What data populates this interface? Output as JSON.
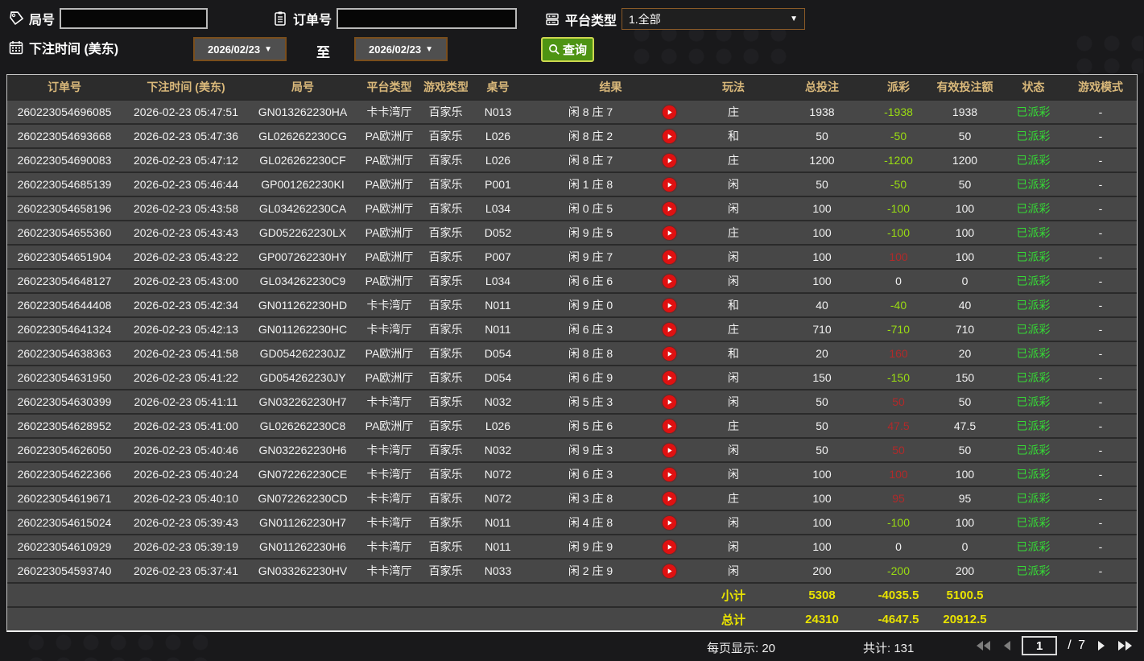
{
  "filters": {
    "round_label": "局号",
    "round_value": "",
    "order_label": "订单号",
    "order_value": "",
    "platform_label": "平台类型",
    "platform_value": "1.全部",
    "bet_time_label": "下注时间 (美东)",
    "date_from": "2026/02/23",
    "to_label": "至",
    "date_to": "2026/02/23",
    "search_label": "查询"
  },
  "colors": {
    "payout_negative": "#9adc12",
    "payout_positive": "#b02a2a",
    "status_green": "#35da35",
    "totals_yellow": "#e9e300",
    "header_gold": "#d9b87a",
    "search_button_green": "#4e9413",
    "play_icon_red": "#e01111"
  },
  "table": {
    "columns": [
      "订单号",
      "下注时间 (美东)",
      "局号",
      "平台类型",
      "游戏类型",
      "桌号",
      "结果",
      "玩法",
      "总投注",
      "派彩",
      "有效投注额",
      "状态",
      "游戏模式"
    ],
    "rows": [
      {
        "order_id": "260223054696085",
        "bet_time": "2026-02-23 05:47:51",
        "round_id": "GN013262230HA",
        "platform": "卡卡湾厅",
        "game_type": "百家乐",
        "table_no": "N013",
        "result": "闲 8 庄 7",
        "bet_type": "庄",
        "total_bet": "1938",
        "payout": "-1938",
        "payout_class": "pay-neg",
        "valid_bet": "1938",
        "status": "已派彩",
        "game_mode": "-"
      },
      {
        "order_id": "260223054693668",
        "bet_time": "2026-02-23 05:47:36",
        "round_id": "GL026262230CG",
        "platform": "PA欧洲厅",
        "game_type": "百家乐",
        "table_no": "L026",
        "result": "闲 8 庄 2",
        "bet_type": "和",
        "total_bet": "50",
        "payout": "-50",
        "payout_class": "pay-neg",
        "valid_bet": "50",
        "status": "已派彩",
        "game_mode": "-"
      },
      {
        "order_id": "260223054690083",
        "bet_time": "2026-02-23 05:47:12",
        "round_id": "GL026262230CF",
        "platform": "PA欧洲厅",
        "game_type": "百家乐",
        "table_no": "L026",
        "result": "闲 8 庄 7",
        "bet_type": "庄",
        "total_bet": "1200",
        "payout": "-1200",
        "payout_class": "pay-neg",
        "valid_bet": "1200",
        "status": "已派彩",
        "game_mode": "-"
      },
      {
        "order_id": "260223054685139",
        "bet_time": "2026-02-23 05:46:44",
        "round_id": "GP001262230KI",
        "platform": "PA欧洲厅",
        "game_type": "百家乐",
        "table_no": "P001",
        "result": "闲 1 庄 8",
        "bet_type": "闲",
        "total_bet": "50",
        "payout": "-50",
        "payout_class": "pay-neg",
        "valid_bet": "50",
        "status": "已派彩",
        "game_mode": "-"
      },
      {
        "order_id": "260223054658196",
        "bet_time": "2026-02-23 05:43:58",
        "round_id": "GL034262230CA",
        "platform": "PA欧洲厅",
        "game_type": "百家乐",
        "table_no": "L034",
        "result": "闲 0 庄 5",
        "bet_type": "闲",
        "total_bet": "100",
        "payout": "-100",
        "payout_class": "pay-neg",
        "valid_bet": "100",
        "status": "已派彩",
        "game_mode": "-"
      },
      {
        "order_id": "260223054655360",
        "bet_time": "2026-02-23 05:43:43",
        "round_id": "GD052262230LX",
        "platform": "PA欧洲厅",
        "game_type": "百家乐",
        "table_no": "D052",
        "result": "闲 9 庄 5",
        "bet_type": "庄",
        "total_bet": "100",
        "payout": "-100",
        "payout_class": "pay-neg",
        "valid_bet": "100",
        "status": "已派彩",
        "game_mode": "-"
      },
      {
        "order_id": "260223054651904",
        "bet_time": "2026-02-23 05:43:22",
        "round_id": "GP007262230HY",
        "platform": "PA欧洲厅",
        "game_type": "百家乐",
        "table_no": "P007",
        "result": "闲 9 庄 7",
        "bet_type": "闲",
        "total_bet": "100",
        "payout": "100",
        "payout_class": "pay-pos",
        "valid_bet": "100",
        "status": "已派彩",
        "game_mode": "-"
      },
      {
        "order_id": "260223054648127",
        "bet_time": "2026-02-23 05:43:00",
        "round_id": "GL034262230C9",
        "platform": "PA欧洲厅",
        "game_type": "百家乐",
        "table_no": "L034",
        "result": "闲 6 庄 6",
        "bet_type": "闲",
        "total_bet": "100",
        "payout": "0",
        "payout_class": "pay-zero",
        "valid_bet": "0",
        "status": "已派彩",
        "game_mode": "-"
      },
      {
        "order_id": "260223054644408",
        "bet_time": "2026-02-23 05:42:34",
        "round_id": "GN011262230HD",
        "platform": "卡卡湾厅",
        "game_type": "百家乐",
        "table_no": "N011",
        "result": "闲 9 庄 0",
        "bet_type": "和",
        "total_bet": "40",
        "payout": "-40",
        "payout_class": "pay-neg",
        "valid_bet": "40",
        "status": "已派彩",
        "game_mode": "-"
      },
      {
        "order_id": "260223054641324",
        "bet_time": "2026-02-23 05:42:13",
        "round_id": "GN011262230HC",
        "platform": "卡卡湾厅",
        "game_type": "百家乐",
        "table_no": "N011",
        "result": "闲 6 庄 3",
        "bet_type": "庄",
        "total_bet": "710",
        "payout": "-710",
        "payout_class": "pay-neg",
        "valid_bet": "710",
        "status": "已派彩",
        "game_mode": "-"
      },
      {
        "order_id": "260223054638363",
        "bet_time": "2026-02-23 05:41:58",
        "round_id": "GD054262230JZ",
        "platform": "PA欧洲厅",
        "game_type": "百家乐",
        "table_no": "D054",
        "result": "闲 8 庄 8",
        "bet_type": "和",
        "total_bet": "20",
        "payout": "160",
        "payout_class": "pay-pos",
        "valid_bet": "20",
        "status": "已派彩",
        "game_mode": "-"
      },
      {
        "order_id": "260223054631950",
        "bet_time": "2026-02-23 05:41:22",
        "round_id": "GD054262230JY",
        "platform": "PA欧洲厅",
        "game_type": "百家乐",
        "table_no": "D054",
        "result": "闲 6 庄 9",
        "bet_type": "闲",
        "total_bet": "150",
        "payout": "-150",
        "payout_class": "pay-neg",
        "valid_bet": "150",
        "status": "已派彩",
        "game_mode": "-"
      },
      {
        "order_id": "260223054630399",
        "bet_time": "2026-02-23 05:41:11",
        "round_id": "GN032262230H7",
        "platform": "卡卡湾厅",
        "game_type": "百家乐",
        "table_no": "N032",
        "result": "闲 5 庄 3",
        "bet_type": "闲",
        "total_bet": "50",
        "payout": "50",
        "payout_class": "pay-pos",
        "valid_bet": "50",
        "status": "已派彩",
        "game_mode": "-"
      },
      {
        "order_id": "260223054628952",
        "bet_time": "2026-02-23 05:41:00",
        "round_id": "GL026262230C8",
        "platform": "PA欧洲厅",
        "game_type": "百家乐",
        "table_no": "L026",
        "result": "闲 5 庄 6",
        "bet_type": "庄",
        "total_bet": "50",
        "payout": "47.5",
        "payout_class": "pay-pos",
        "valid_bet": "47.5",
        "status": "已派彩",
        "game_mode": "-"
      },
      {
        "order_id": "260223054626050",
        "bet_time": "2026-02-23 05:40:46",
        "round_id": "GN032262230H6",
        "platform": "卡卡湾厅",
        "game_type": "百家乐",
        "table_no": "N032",
        "result": "闲 9 庄 3",
        "bet_type": "闲",
        "total_bet": "50",
        "payout": "50",
        "payout_class": "pay-pos",
        "valid_bet": "50",
        "status": "已派彩",
        "game_mode": "-"
      },
      {
        "order_id": "260223054622366",
        "bet_time": "2026-02-23 05:40:24",
        "round_id": "GN072262230CE",
        "platform": "卡卡湾厅",
        "game_type": "百家乐",
        "table_no": "N072",
        "result": "闲 6 庄 3",
        "bet_type": "闲",
        "total_bet": "100",
        "payout": "100",
        "payout_class": "pay-pos",
        "valid_bet": "100",
        "status": "已派彩",
        "game_mode": "-"
      },
      {
        "order_id": "260223054619671",
        "bet_time": "2026-02-23 05:40:10",
        "round_id": "GN072262230CD",
        "platform": "卡卡湾厅",
        "game_type": "百家乐",
        "table_no": "N072",
        "result": "闲 3 庄 8",
        "bet_type": "庄",
        "total_bet": "100",
        "payout": "95",
        "payout_class": "pay-pos",
        "valid_bet": "95",
        "status": "已派彩",
        "game_mode": "-"
      },
      {
        "order_id": "260223054615024",
        "bet_time": "2026-02-23 05:39:43",
        "round_id": "GN011262230H7",
        "platform": "卡卡湾厅",
        "game_type": "百家乐",
        "table_no": "N011",
        "result": "闲 4 庄 8",
        "bet_type": "闲",
        "total_bet": "100",
        "payout": "-100",
        "payout_class": "pay-neg",
        "valid_bet": "100",
        "status": "已派彩",
        "game_mode": "-"
      },
      {
        "order_id": "260223054610929",
        "bet_time": "2026-02-23 05:39:19",
        "round_id": "GN011262230H6",
        "platform": "卡卡湾厅",
        "game_type": "百家乐",
        "table_no": "N011",
        "result": "闲 9 庄 9",
        "bet_type": "闲",
        "total_bet": "100",
        "payout": "0",
        "payout_class": "pay-zero",
        "valid_bet": "0",
        "status": "已派彩",
        "game_mode": "-"
      },
      {
        "order_id": "260223054593740",
        "bet_time": "2026-02-23 05:37:41",
        "round_id": "GN033262230HV",
        "platform": "卡卡湾厅",
        "game_type": "百家乐",
        "table_no": "N033",
        "result": "闲 2 庄 9",
        "bet_type": "闲",
        "total_bet": "200",
        "payout": "-200",
        "payout_class": "pay-neg",
        "valid_bet": "200",
        "status": "已派彩",
        "game_mode": "-"
      }
    ],
    "subtotal": {
      "label": "小计",
      "total_bet": "5308",
      "payout": "-4035.5",
      "valid_bet": "5100.5"
    },
    "grand_total": {
      "label": "总计",
      "total_bet": "24310",
      "payout": "-4647.5",
      "valid_bet": "20912.5"
    }
  },
  "footer": {
    "page_size_text": "每页显示: 20",
    "total_count_text": "共计: 131",
    "current_page": "1",
    "page_separator": "/",
    "total_pages": "7"
  }
}
